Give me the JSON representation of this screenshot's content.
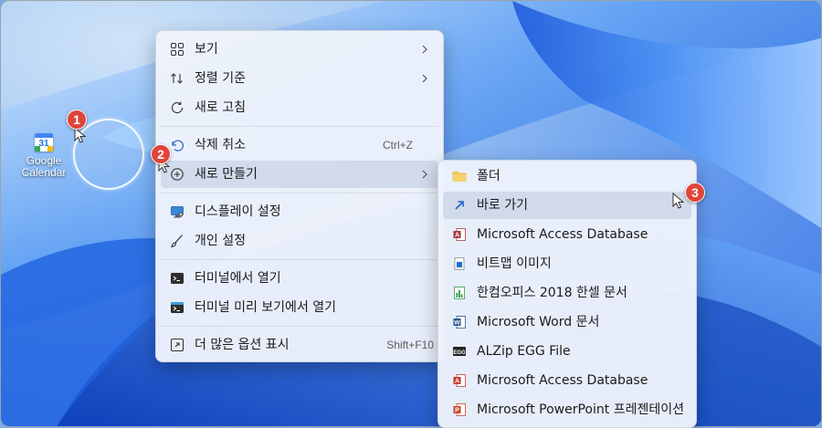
{
  "desktop": {
    "icon_label_line1": "Google",
    "icon_label_line2": "Calendar",
    "calendar_day": "31",
    "badges": [
      "1",
      "2",
      "3"
    ]
  },
  "context_menu": {
    "items": [
      {
        "label": "보기",
        "icon": "grid-icon",
        "submenu": true
      },
      {
        "label": "정렬 기준",
        "icon": "sort-arrows-icon",
        "submenu": true
      },
      {
        "label": "새로 고침",
        "icon": "refresh-icon"
      },
      {
        "label": "삭제 취소",
        "icon": "undo-icon",
        "shortcut": "Ctrl+Z"
      },
      {
        "label": "새로 만들기",
        "icon": "new-plus-icon",
        "submenu": true,
        "highlighted": true
      },
      {
        "label": "디스플레이 설정",
        "icon": "display-icon"
      },
      {
        "label": "개인 설정",
        "icon": "brush-icon"
      },
      {
        "label": "터미널에서 열기",
        "icon": "terminal-icon"
      },
      {
        "label": "터미널 미리 보기에서 열기",
        "icon": "terminal-preview-icon"
      },
      {
        "label": "더 많은 옵션 표시",
        "icon": "expand-icon",
        "shortcut": "Shift+F10"
      }
    ]
  },
  "new_submenu": {
    "items": [
      {
        "label": "폴더",
        "icon": "folder-icon"
      },
      {
        "label": "바로 가기",
        "icon": "shortcut-arrow-icon",
        "highlighted": true
      },
      {
        "label": "Microsoft Access Database",
        "icon": "access-icon"
      },
      {
        "label": "비트맵 이미지",
        "icon": "bitmap-icon"
      },
      {
        "label": "한컴오피스 2018 한셀 문서",
        "icon": "hancell-icon"
      },
      {
        "label": "Microsoft Word 문서",
        "icon": "word-icon"
      },
      {
        "label": "ALZip EGG File",
        "icon": "egg-icon"
      },
      {
        "label": "Microsoft Access Database",
        "icon": "access-icon"
      },
      {
        "label": "Microsoft PowerPoint 프레젠테이션",
        "icon": "powerpoint-icon"
      }
    ]
  },
  "colors": {
    "badge": "#e0453a",
    "menu_bg": "#eef2fb",
    "highlight": "#b4c0d8",
    "accent": "#1a73e8"
  }
}
